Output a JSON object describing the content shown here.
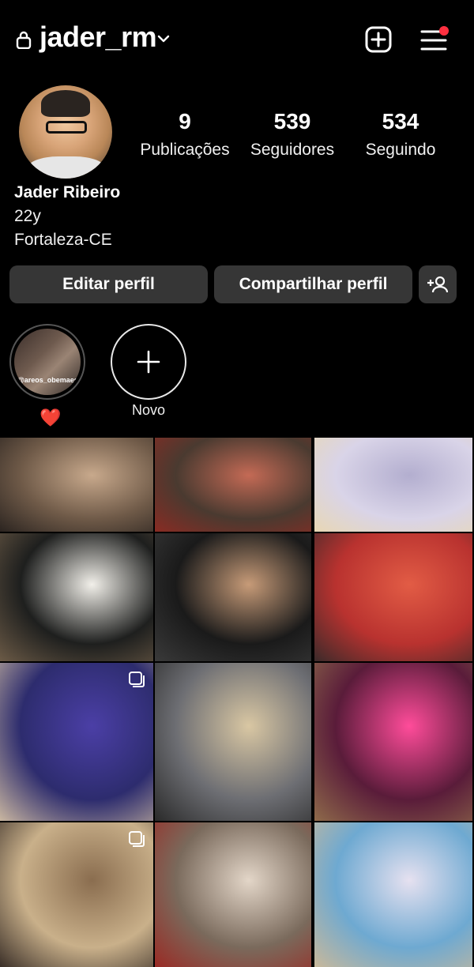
{
  "header": {
    "username": "jader_rm",
    "icons": [
      "lock-icon",
      "chevron-down-icon",
      "new-post-icon",
      "menu-icon"
    ],
    "notification_dot_color": "#ff3040"
  },
  "profile": {
    "name": "Jader Ribeiro",
    "bio_line_1": "22y",
    "bio_line_2": "Fortaleza-CE",
    "stats": [
      {
        "value": "9",
        "label": "Publicações"
      },
      {
        "value": "539",
        "label": "Seguidores"
      },
      {
        "value": "534",
        "label": "Seguindo"
      }
    ]
  },
  "actions": {
    "edit_label": "Editar perfil",
    "share_label": "Compartilhar perfil",
    "discover_icon": "add-person-icon"
  },
  "highlights": [
    {
      "caption": "❤️",
      "image_text": "@areos_obemaes\nto de casal by"
    },
    {
      "caption": "Novo"
    }
  ],
  "grid": {
    "columns": 3,
    "posts": [
      {
        "scene": "couple-selfie",
        "colors": [
          "#6f5a48",
          "#c8a98c",
          "#2b2420"
        ]
      },
      {
        "scene": "couple-selfie",
        "colors": [
          "#4a3a30",
          "#c46a55",
          "#8a2b23"
        ]
      },
      {
        "scene": "superman-shirt-beach",
        "colors": [
          "#d9d4e8",
          "#b3aecf",
          "#e8d7b4"
        ]
      },
      {
        "scene": "chalkboard-wall",
        "colors": [
          "#1e1f1e",
          "#f2f0ea",
          "#6b5a46"
        ]
      },
      {
        "scene": "mirror-selfie",
        "colors": [
          "#1a1a1a",
          "#c79b78",
          "#3a3a3a"
        ]
      },
      {
        "scene": "red-lights-back",
        "colors": [
          "#b9322f",
          "#e25c45",
          "#3b2a2a"
        ]
      },
      {
        "scene": "blue-neon-room",
        "colors": [
          "#2d2c6e",
          "#4b3fa6",
          "#c9b6a0"
        ],
        "multi": true
      },
      {
        "scene": "wanted-posters",
        "colors": [
          "#6d6e73",
          "#d9c7a3",
          "#2a2a2a"
        ]
      },
      {
        "scene": "amusement-park",
        "colors": [
          "#5a1c3a",
          "#ff4c9a",
          "#8e6a4a"
        ]
      },
      {
        "scene": "couple-2021",
        "colors": [
          "#c9b08a",
          "#8a6d4f",
          "#3a2f28"
        ],
        "multi": true
      },
      {
        "scene": "couple-selfie",
        "colors": [
          "#7a6a5c",
          "#e3d6c8",
          "#9a2a24"
        ]
      },
      {
        "scene": "beach-superman",
        "colors": [
          "#6ea9d1",
          "#e6e1f0",
          "#c9b89a"
        ]
      }
    ]
  }
}
